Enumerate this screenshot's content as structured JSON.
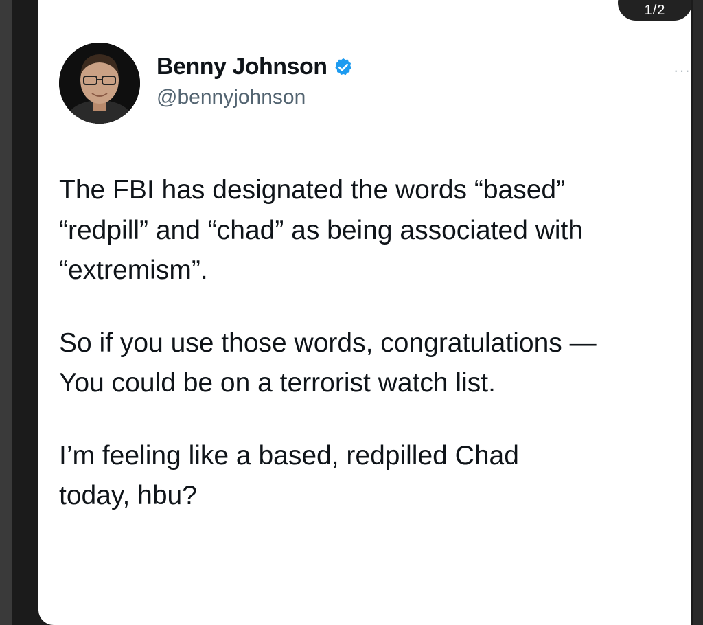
{
  "pager": {
    "label": "1/2"
  },
  "author": {
    "name": "Benny Johnson",
    "handle": "@bennyjohnson",
    "verified_color": "#1d9bf0"
  },
  "menu": {
    "label": "···"
  },
  "tweet": {
    "paragraphs": [
      "The FBI has designated the words “based”\n“redpill” and “chad” as being associated with\n“extremism”.",
      "So if you use those words, congratulations —\nYou could be on a terrorist watch list.",
      "I’m feeling like a based, redpilled Chad\ntoday, hbu?"
    ]
  }
}
